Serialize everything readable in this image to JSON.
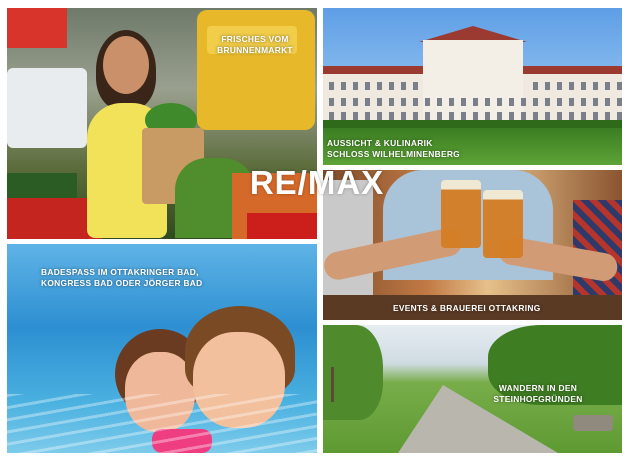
{
  "tiles": {
    "market": {
      "caption_line1": "FRISCHES VOM",
      "caption_line2": "BRUNNENMARKT"
    },
    "palace": {
      "caption_line1": "AUSSICHT & KULINARIK",
      "caption_line2": "SCHLOSS WILHELMINENBERG"
    },
    "beer": {
      "caption_line1": "EVENTS & BRAUEREI OTTAKRING"
    },
    "pool": {
      "caption_line1": "BADESPASS IM OTTAKRINGER BAD,",
      "caption_line2": "KONGRESS BAD ODER JÖRGER BAD"
    },
    "path": {
      "caption_line1": "WANDERN IN DEN",
      "caption_line2": "STEINHOFGRÜNDEN"
    }
  },
  "logo": {
    "text": "RE/MAX"
  },
  "colors": {
    "caption": "#ffffff",
    "background": "#ffffff"
  }
}
